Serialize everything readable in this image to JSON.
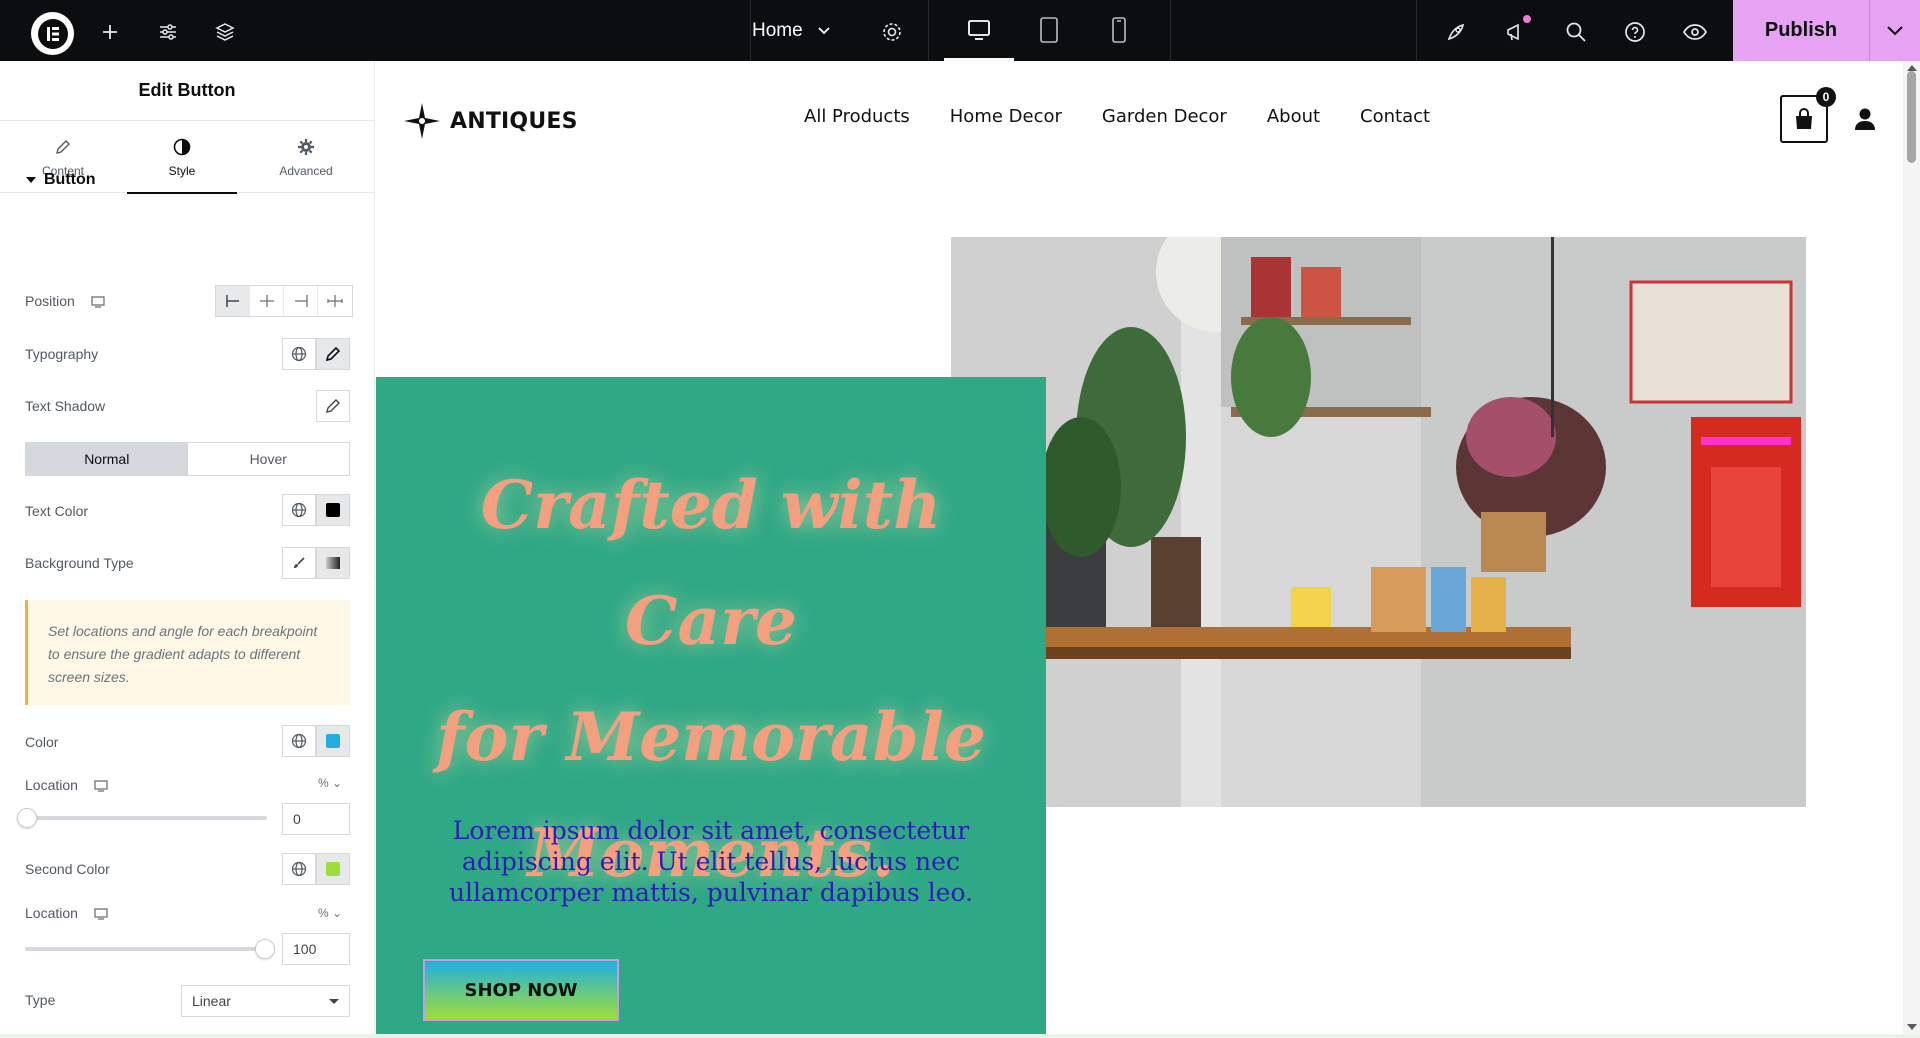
{
  "topbar": {
    "page_name": "Home",
    "publish_label": "Publish",
    "icons": [
      "elementor-logo-icon",
      "add-icon",
      "site-settings-icon",
      "structure-icon",
      "page-settings-icon",
      "desktop-icon",
      "tablet-icon",
      "mobile-icon",
      "launch-icon",
      "whats-new-icon",
      "search-icon",
      "help-icon",
      "preview-icon",
      "chevron-down-icon"
    ],
    "accent_color": "#e6a3f3"
  },
  "panel": {
    "title": "Edit Button",
    "tabs": [
      {
        "label": "Content"
      },
      {
        "label": "Style"
      },
      {
        "label": "Advanced"
      }
    ],
    "active_tab": "Style",
    "section": "Button",
    "labels": {
      "position": "Position",
      "typography": "Typography",
      "text_shadow": "Text Shadow",
      "text_color": "Text Color",
      "background_type": "Background Type",
      "color": "Color",
      "location": "Location",
      "second_color": "Second Color",
      "location2": "Location",
      "type": "Type"
    },
    "state_toggle": {
      "normal": "Normal",
      "hover": "Hover",
      "active": "Normal"
    },
    "notice": "Set locations and angle for each breakpoint to ensure the gradient adapts to different screen sizes.",
    "text_color_value": "#000000",
    "color_value": "#22aee0",
    "second_color_value": "#9ede3a",
    "unit": "%",
    "location_value": "0",
    "location_fraction": 0,
    "location2_value": "100",
    "location2_fraction": 1,
    "type_value": "Linear"
  },
  "site": {
    "brand": "ANTIQUES",
    "nav": [
      "All Products",
      "Home Decor",
      "Garden Decor",
      "About",
      "Contact"
    ],
    "cart_count": "0",
    "hero_title_lines": [
      "Crafted with Care",
      "for Memorable",
      "Moments."
    ],
    "hero_text": "Lorem ipsum dolor sit amet, consectetur adipiscing elit. Ut elit tellus, luctus nec ullamcorper mattis, pulvinar dapibus leo.",
    "button_label": "SHOP NOW",
    "hero_bg_color": "#2fa886",
    "title_color": "#f2a07f",
    "text_color": "#2c1fb5"
  }
}
